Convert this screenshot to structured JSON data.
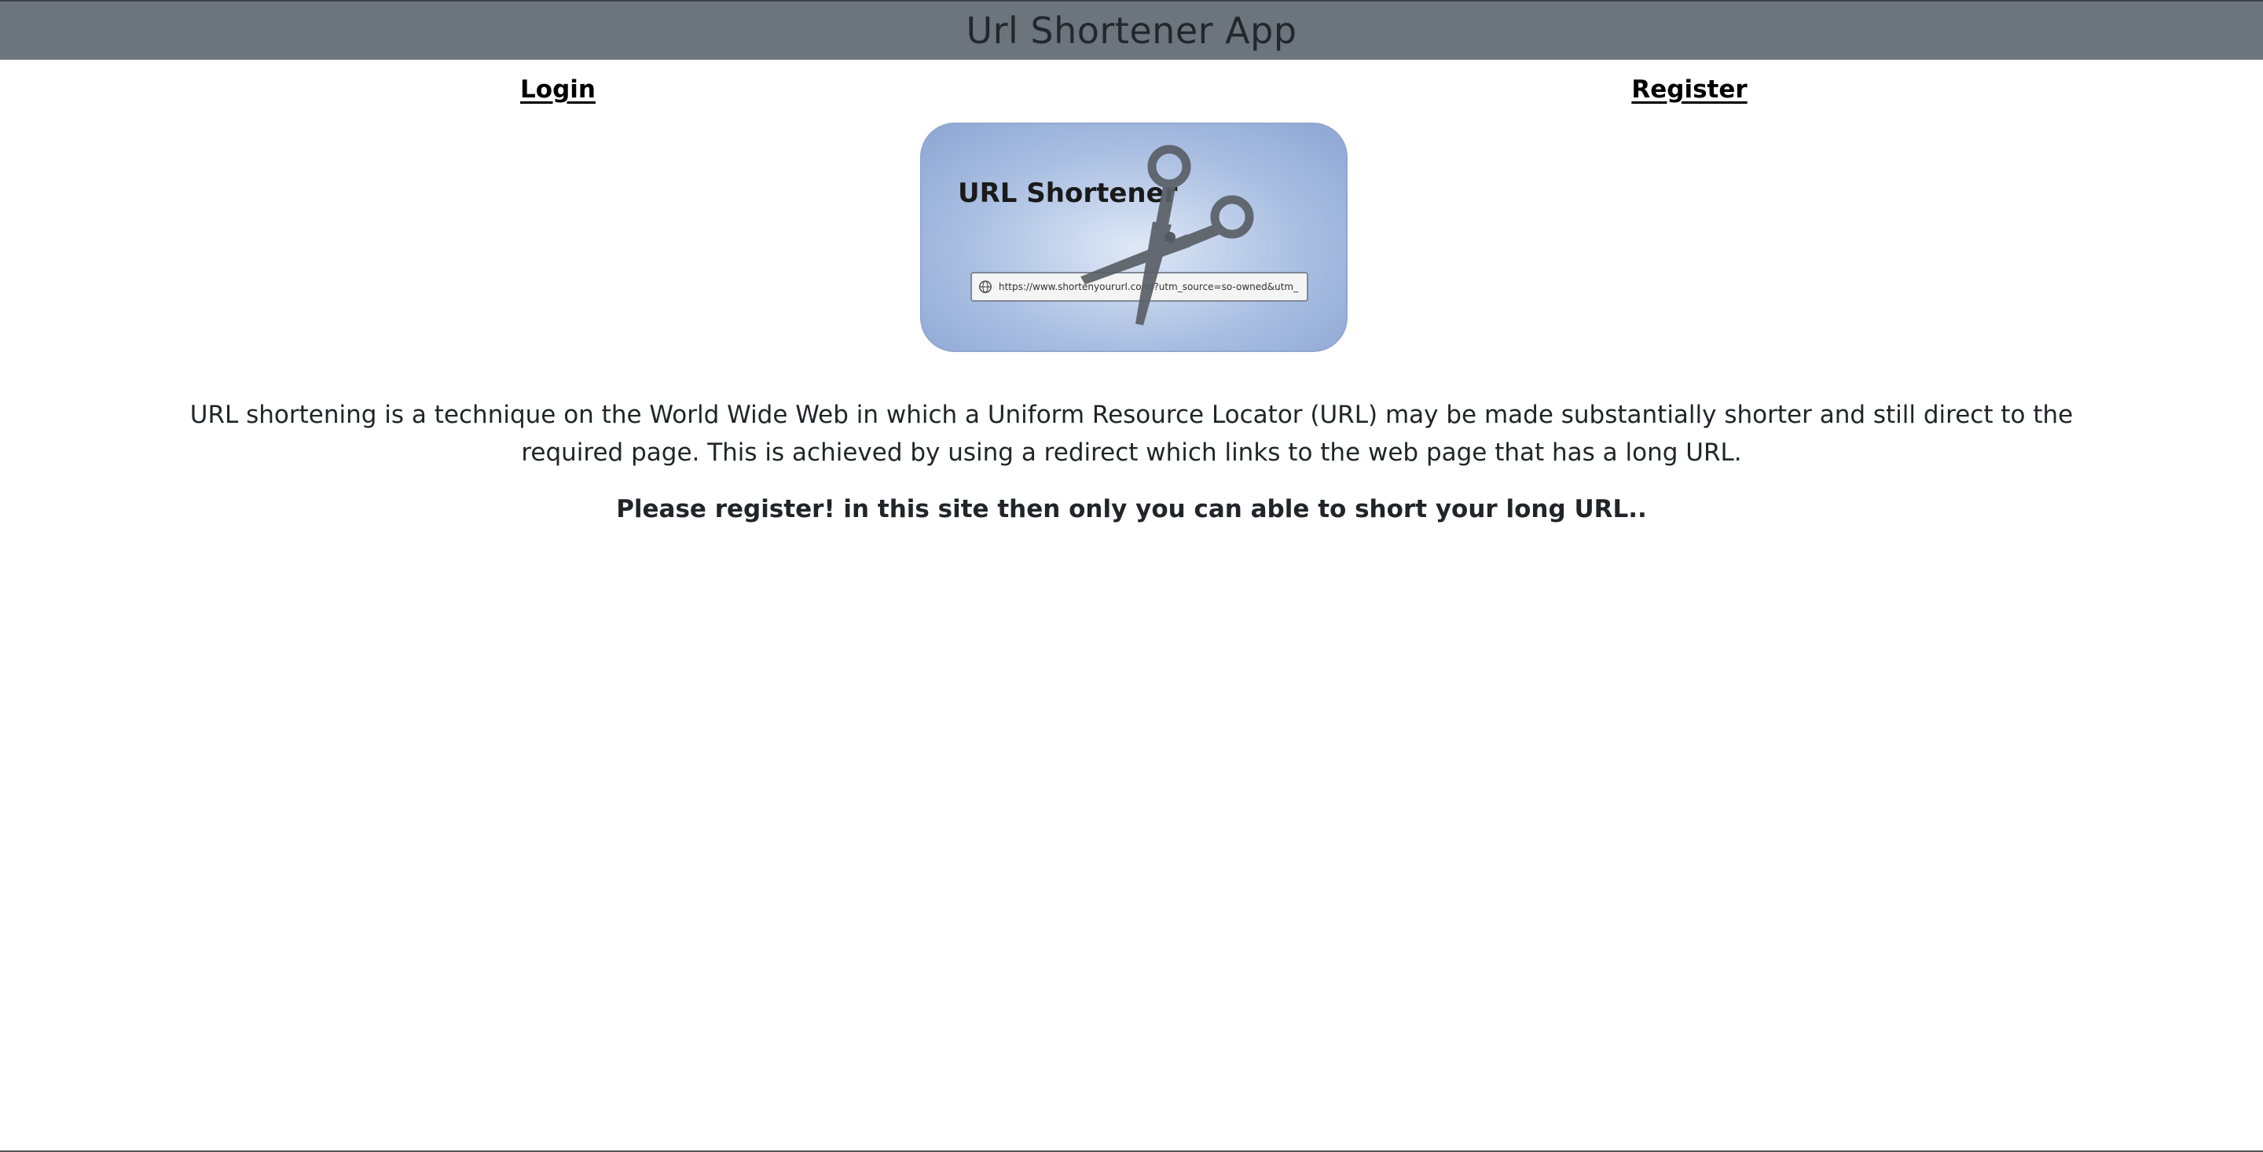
{
  "app": {
    "title": "Url Shortener App"
  },
  "nav": {
    "login_label": "Login",
    "register_label": "Register"
  },
  "hero": {
    "title": "URL Shortener",
    "url_text": "https://www.shortenyoururl.com/?utm_source=so-owned&utm_",
    "icons": [
      "globe-icon",
      "scissors-icon"
    ]
  },
  "content": {
    "description": "URL shortening is a technique on the World Wide Web in which a Uniform Resource Locator (URL) may be made substantially shorter and still direct to the required page. This is achieved by using a redirect which links to the web page that has a long URL.",
    "cta": "Please register! in this site then only you can able to short your long URL.."
  },
  "colors": {
    "header_bg": "#6c757d",
    "text": "#212529",
    "hero_blue": "#8ca6d3"
  }
}
